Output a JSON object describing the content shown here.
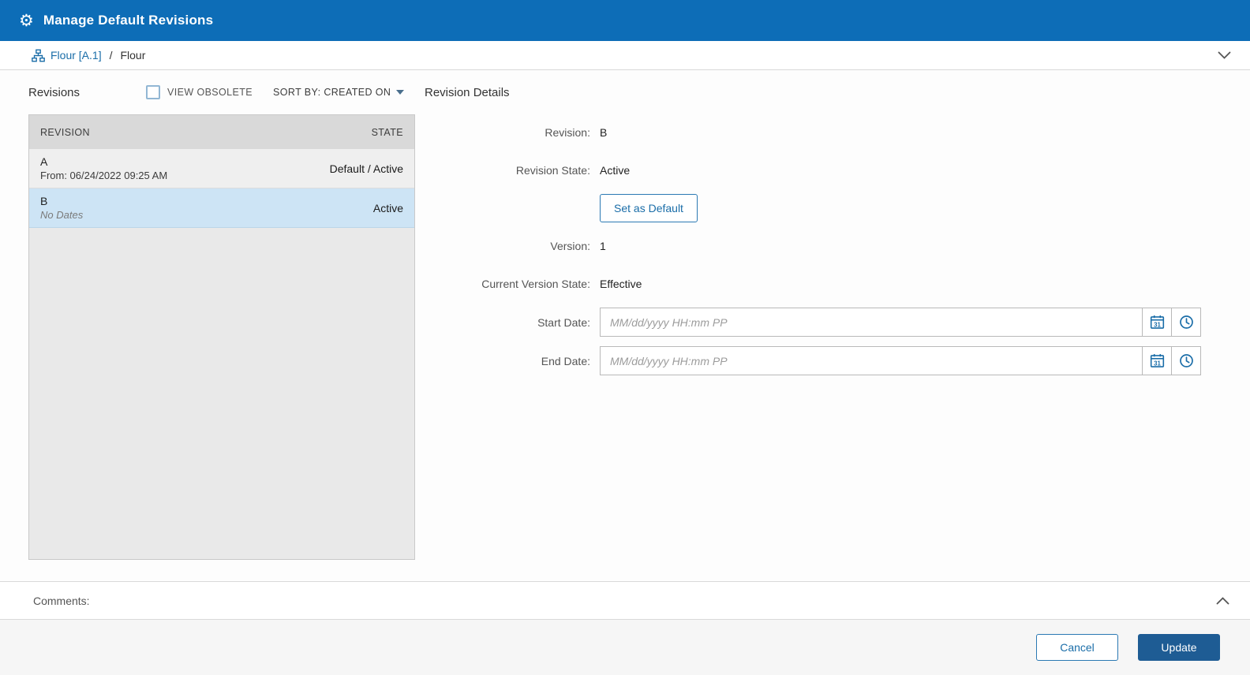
{
  "titlebar": {
    "title": "Manage Default Revisions"
  },
  "breadcrumb": {
    "link": "Flour [A.1]",
    "separator": "/",
    "current": "Flour"
  },
  "revisions": {
    "heading": "Revisions",
    "view_obsolete": "VIEW OBSOLETE",
    "sort_by": "SORT BY: CREATED ON",
    "columns": {
      "revision": "REVISION",
      "state": "STATE"
    },
    "rows": [
      {
        "revision": "A",
        "dates": "From: 06/24/2022 09:25 AM",
        "state": "Default / Active"
      },
      {
        "revision": "B",
        "dates": "No Dates",
        "state": "Active"
      }
    ]
  },
  "details": {
    "heading": "Revision Details",
    "revision_label": "Revision:",
    "revision_value": "B",
    "revision_state_label": "Revision State:",
    "revision_state_value": "Active",
    "set_default_button": "Set as Default",
    "version_label": "Version:",
    "version_value": "1",
    "current_version_state_label": "Current Version State:",
    "current_version_state_value": "Effective",
    "start_date_label": "Start Date:",
    "end_date_label": "End Date:",
    "date_placeholder": "MM/dd/yyyy HH:mm PP",
    "calendar_icon_day": "31"
  },
  "comments": {
    "label": "Comments:"
  },
  "footer": {
    "cancel": "Cancel",
    "update": "Update"
  },
  "colors": {
    "header_blue": "#0d6db7",
    "accent_blue": "#1a6da8",
    "selected_row": "#cde4f5",
    "primary_button": "#1e5c94"
  }
}
